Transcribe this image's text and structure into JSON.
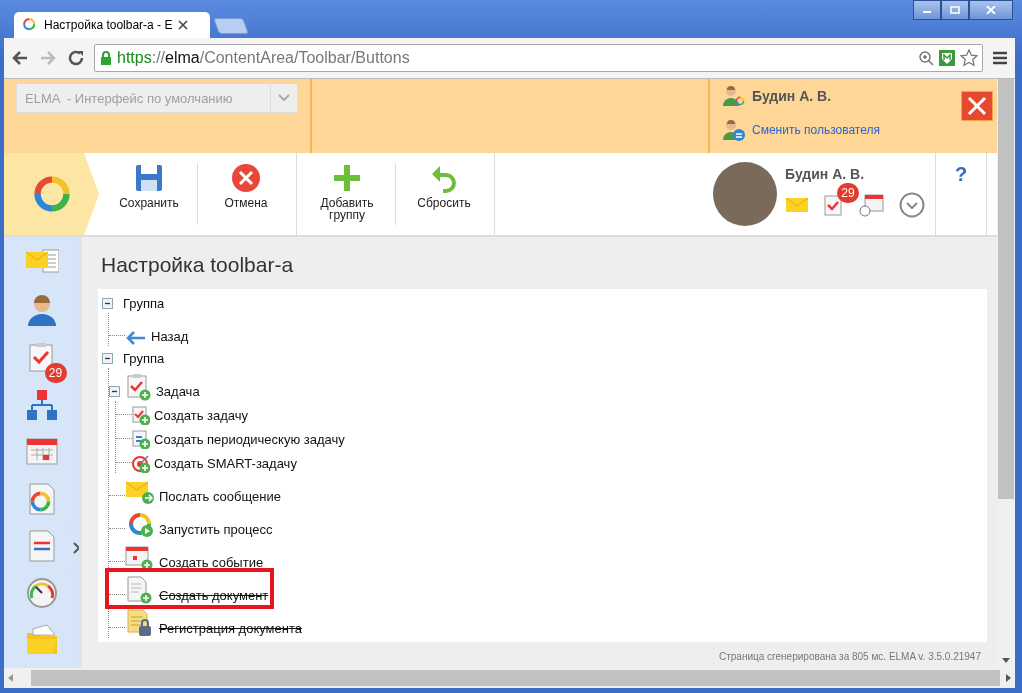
{
  "browser": {
    "tab_title": "Настройка toolbar-a - E",
    "url": {
      "scheme": "https",
      "separator": "://",
      "host": "elma",
      "path": "/ContentArea/Toolbar/Buttons"
    }
  },
  "header": {
    "interface_select": {
      "value": "ELMA  - Интерфейс по умолчанию",
      "disabled": true
    },
    "user_name": "Будин А. В.",
    "switch_user": "Сменить пользователя"
  },
  "toolbar": {
    "groups": [
      [
        {
          "label": "Сохранить",
          "kind": "save"
        },
        {
          "label": "Отмена",
          "kind": "cancel"
        }
      ],
      [
        {
          "label": "Добавить группу",
          "kind": "add"
        },
        {
          "label": "Сбросить",
          "kind": "reset"
        }
      ]
    ],
    "user_name": "Будин А. В.",
    "tasks_badge": "29",
    "help": "?"
  },
  "sidebar": {
    "items": [
      {
        "kind": "mail"
      },
      {
        "kind": "user"
      },
      {
        "kind": "tasks",
        "badge": "29"
      },
      {
        "kind": "org"
      },
      {
        "kind": "calendar"
      },
      {
        "kind": "process"
      },
      {
        "kind": "document"
      },
      {
        "kind": "gauge"
      },
      {
        "kind": "folder"
      }
    ]
  },
  "page": {
    "title": "Настройка toolbar-a",
    "tree": [
      {
        "label": "Группа",
        "kind": "group",
        "expanded": true,
        "struck": false,
        "highlighted": false,
        "children": [
          {
            "label": "Назад",
            "kind": "back",
            "struck": false,
            "highlighted": false
          }
        ]
      },
      {
        "label": "Группа",
        "kind": "group",
        "expanded": true,
        "struck": false,
        "highlighted": false,
        "children": [
          {
            "label": "Задача",
            "kind": "task",
            "expanded": true,
            "struck": false,
            "highlighted": false,
            "children": [
              {
                "label": "Создать задачу",
                "kind": "task-small",
                "struck": false,
                "highlighted": false
              },
              {
                "label": "Создать периодическую задачу",
                "kind": "periodic",
                "struck": false,
                "highlighted": false
              },
              {
                "label": "Создать SMART-задачу",
                "kind": "smart",
                "struck": false,
                "highlighted": false
              }
            ]
          },
          {
            "label": "Послать сообщение",
            "kind": "message",
            "struck": false,
            "highlighted": false
          },
          {
            "label": "Запустить процесс",
            "kind": "process",
            "struck": false,
            "highlighted": false
          },
          {
            "label": "Создать событие",
            "kind": "event",
            "struck": false,
            "highlighted": false
          },
          {
            "label": "Создать документ",
            "kind": "document",
            "struck": true,
            "highlighted": true
          },
          {
            "label": "Регистрация документа",
            "kind": "registration",
            "struck": true,
            "highlighted": false
          }
        ]
      }
    ],
    "footer": "Страница сгенерирована за 805 мс. ELMA v. 3.5.0.21947"
  }
}
